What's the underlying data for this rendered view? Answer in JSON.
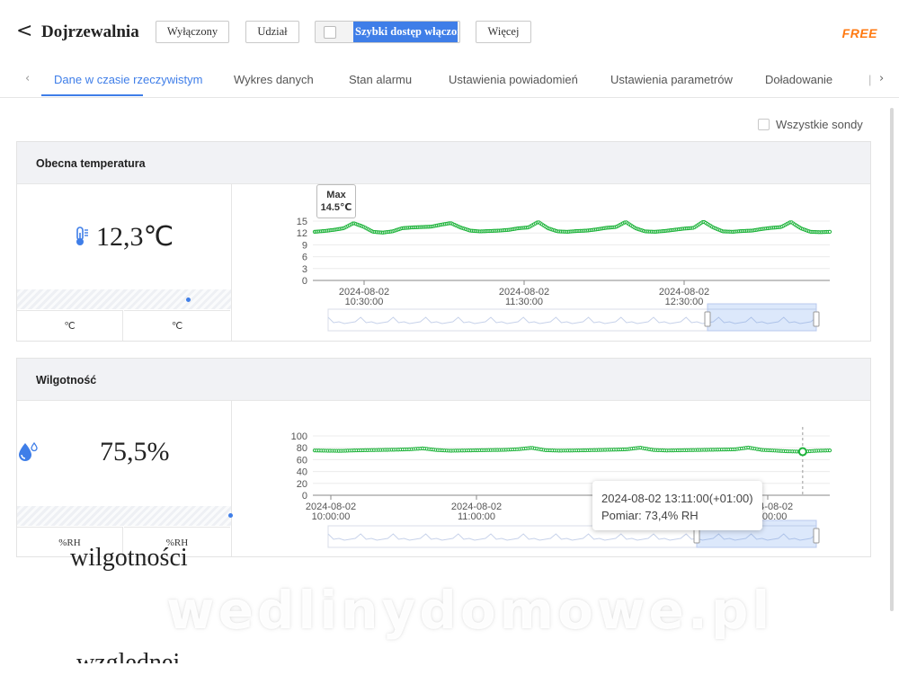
{
  "header": {
    "title": "Dojrzewalnia",
    "buttons": {
      "off": "Wyłączony",
      "share": "Udział",
      "more": "Więcej"
    },
    "quick_access": "Szybki dostęp włączony",
    "plan_badge": "FREE"
  },
  "tabs": [
    {
      "label": "Dane w czasie rzeczywistym",
      "active": true
    },
    {
      "label": "Wykres danych"
    },
    {
      "label": "Stan alarmu"
    },
    {
      "label": "Ustawienia powiadomień"
    },
    {
      "label": "Ustawienia parametrów"
    },
    {
      "label": "Doładowanie"
    }
  ],
  "all_probes_label": "Wszystkie sondy",
  "temperature": {
    "title": "Obecna temperatura",
    "value": "12,3℃",
    "unit_left": "℃",
    "unit_right": "℃",
    "icon": "thermometer-icon",
    "max_tooltip": {
      "label": "Max",
      "value": "14.5℃"
    },
    "chart_data": {
      "type": "line",
      "series": [
        {
          "values": [
            12.3,
            12.5,
            12.8,
            13.2,
            14.5,
            13.6,
            12.3,
            12.1,
            12.4,
            13.2,
            13.4,
            13.5,
            13.6,
            14.1,
            14.5,
            13.4,
            12.6,
            12.4,
            12.5,
            12.6,
            12.8,
            13.2,
            13.4,
            14.8,
            13.2,
            12.4,
            12.3,
            12.5,
            12.6,
            12.9,
            13.3,
            13.5,
            14.8,
            13.2,
            12.4,
            12.3,
            12.5,
            12.8,
            13.1,
            13.3,
            14.9,
            13.4,
            12.4,
            12.3,
            12.5,
            12.6,
            13.0,
            13.3,
            13.5,
            14.8,
            13.2,
            12.3,
            12.2,
            12.3
          ]
        }
      ],
      "ylim": [
        0,
        15
      ],
      "yticks": [
        "0",
        "3",
        "6",
        "9",
        "12",
        "15"
      ],
      "xticks": [
        {
          "date": "2024-08-02",
          "time": "10:30:00"
        },
        {
          "date": "2024-08-02",
          "time": "11:30:00"
        },
        {
          "date": "2024-08-02",
          "time": "12:30:00"
        }
      ],
      "color": "#1db33a"
    }
  },
  "humidity": {
    "title": "Wilgotność",
    "value": "75,5%",
    "unit_left": "%RH",
    "unit_right": "%RH",
    "icon": "water-drop-icon",
    "tooltip": {
      "time": "2024-08-02 13:11:00(+01:00)",
      "reading": "Pomiar: 73,4% RH"
    },
    "chart_data": {
      "type": "line",
      "series": [
        {
          "values": [
            75.5,
            75.0,
            74.8,
            75.6,
            76.0,
            76.4,
            76.8,
            77.5,
            79.0,
            76.2,
            75.0,
            75.4,
            75.8,
            76.2,
            76.5,
            77.6,
            80.0,
            76.0,
            75.2,
            75.4,
            75.8,
            76.3,
            76.8,
            77.4,
            80.2,
            76.3,
            75.4,
            75.8,
            76.2,
            76.6,
            77.0,
            77.4,
            80.4,
            76.4,
            75.2,
            74.0,
            73.4,
            75.0,
            75.6
          ]
        }
      ],
      "ylim": [
        0,
        100
      ],
      "yticks": [
        "0",
        "20",
        "40",
        "60",
        "80",
        "100"
      ],
      "xticks": [
        {
          "date": "2024-08-02",
          "time": "10:00:00"
        },
        {
          "date": "2024-08-02",
          "time": "11:00:00"
        },
        {
          "date": "2024-08-02",
          "time": "12:00:00"
        },
        {
          "date": "2024-08-02",
          "time": "13:00:00"
        }
      ],
      "color": "#1db33a"
    }
  },
  "overlay_text": {
    "line1": "wilgotności",
    "line2": "względnej"
  },
  "watermark": "wedlinydomowe.pl"
}
